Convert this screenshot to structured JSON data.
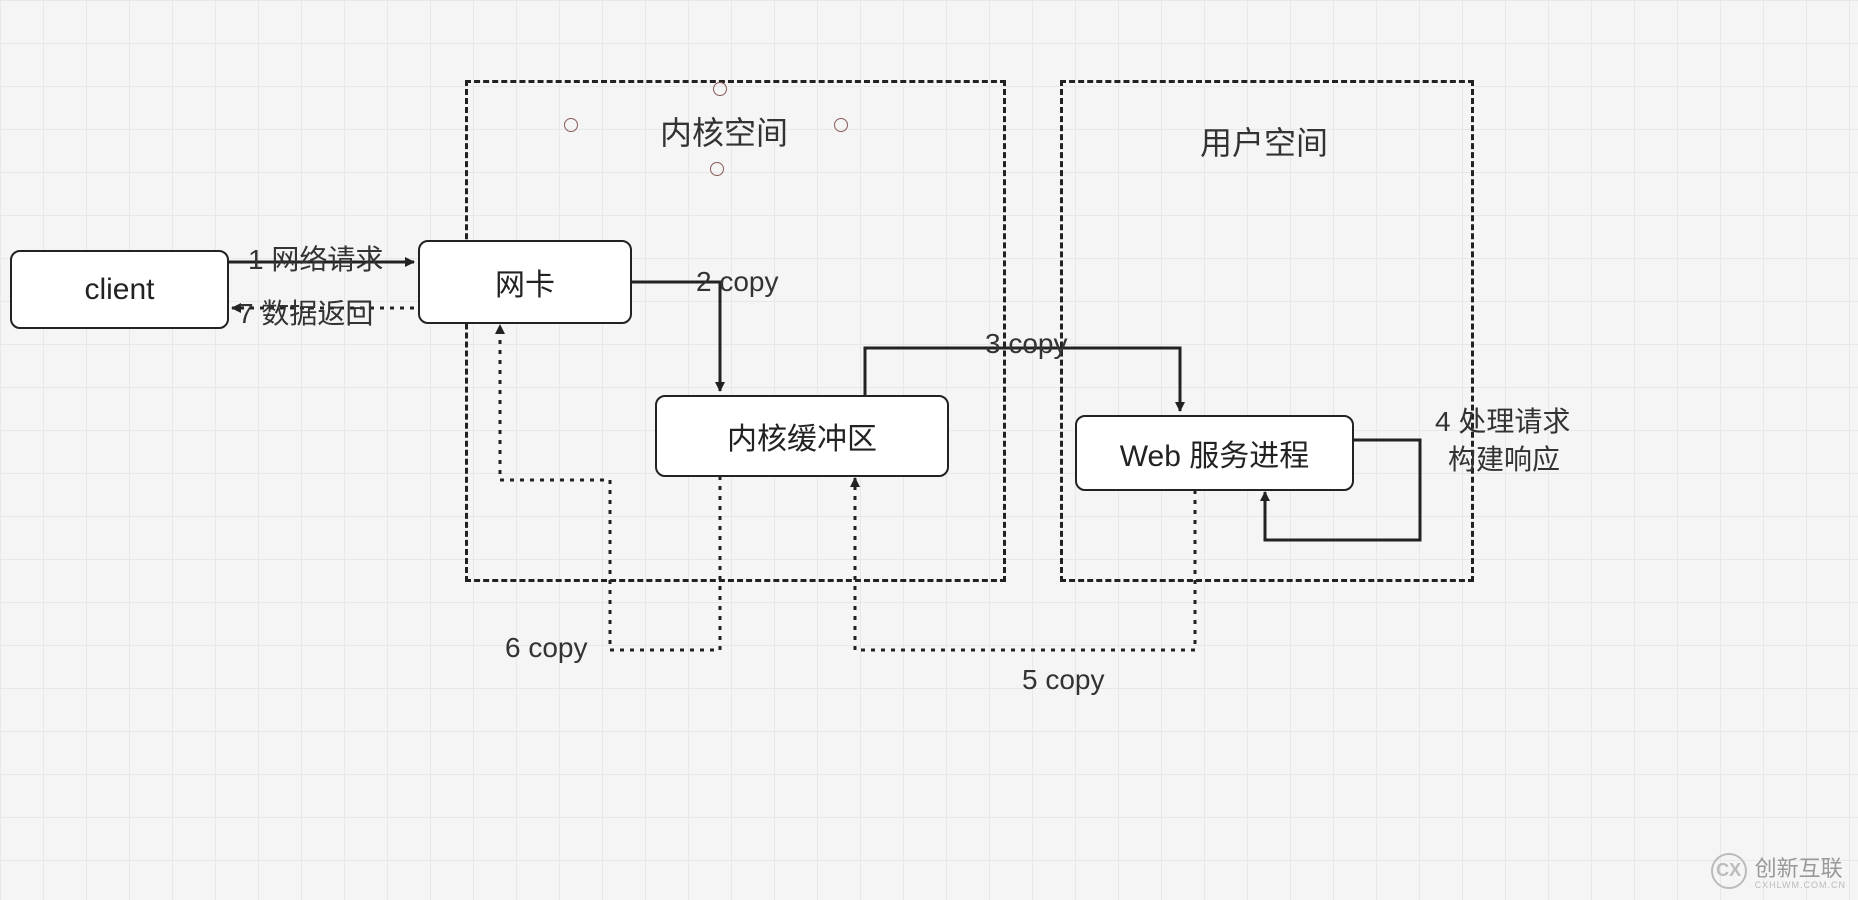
{
  "diagram": {
    "nodes": {
      "client": "client",
      "nic": "网卡",
      "kernel_buffer": "内核缓冲区",
      "web_process": "Web 服务进程"
    },
    "regions": {
      "kernel_space": "内核空间",
      "user_space": "用户空间"
    },
    "edges": {
      "e1": "1 网络请求",
      "e2": "2 copy",
      "e3": "3 copy",
      "e4_line1": "4 处理请求",
      "e4_line2": "构建响应",
      "e5": "5 copy",
      "e6": "6 copy",
      "e7": "7 数据返回"
    }
  },
  "watermark": {
    "icon": "CX",
    "text": "创新互联",
    "sub": "CXHLWM.COM.CN"
  }
}
